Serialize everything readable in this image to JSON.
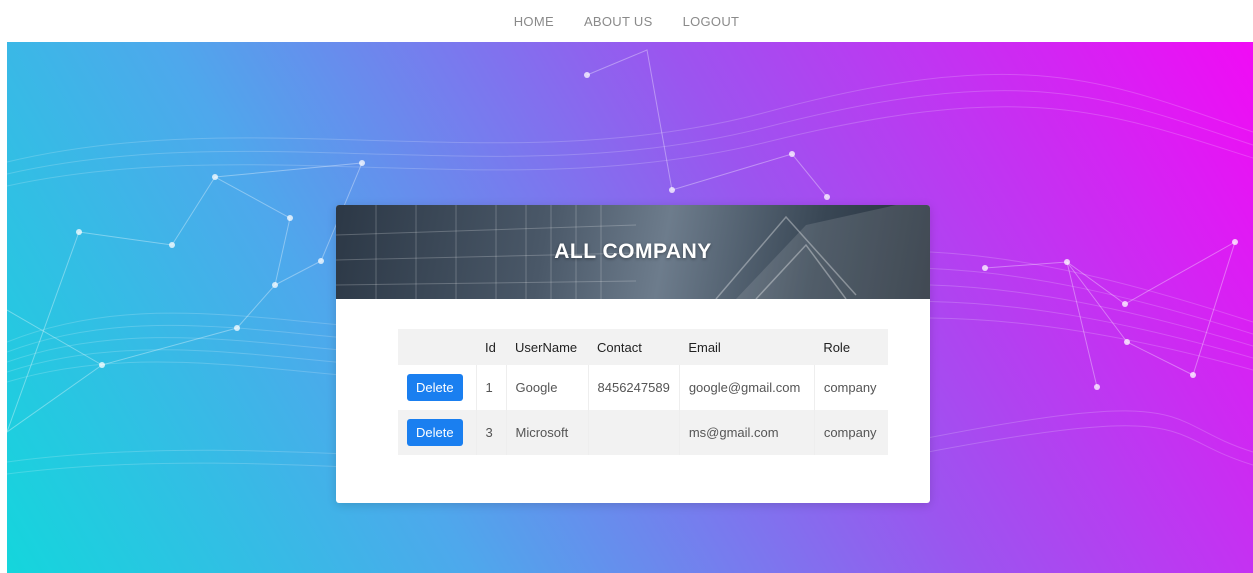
{
  "nav": {
    "items": [
      {
        "label": "HOME"
      },
      {
        "label": "ABOUT US"
      },
      {
        "label": "LOGOUT"
      }
    ]
  },
  "card": {
    "title": "ALL COMPANY"
  },
  "table": {
    "columns": [
      "",
      "Id",
      "UserName",
      "Contact",
      "Email",
      "Role"
    ],
    "rows": [
      {
        "action": "Delete",
        "id": "1",
        "username": "Google",
        "contact": "8456247589",
        "email": "google@gmail.com",
        "role": "company"
      },
      {
        "action": "Delete",
        "id": "3",
        "username": "Microsoft",
        "contact": "",
        "email": "ms@gmail.com",
        "role": "company"
      }
    ]
  },
  "colors": {
    "gradient_start": "#14d6dc",
    "gradient_end": "#f10bf5",
    "button": "#1a7ff0"
  }
}
